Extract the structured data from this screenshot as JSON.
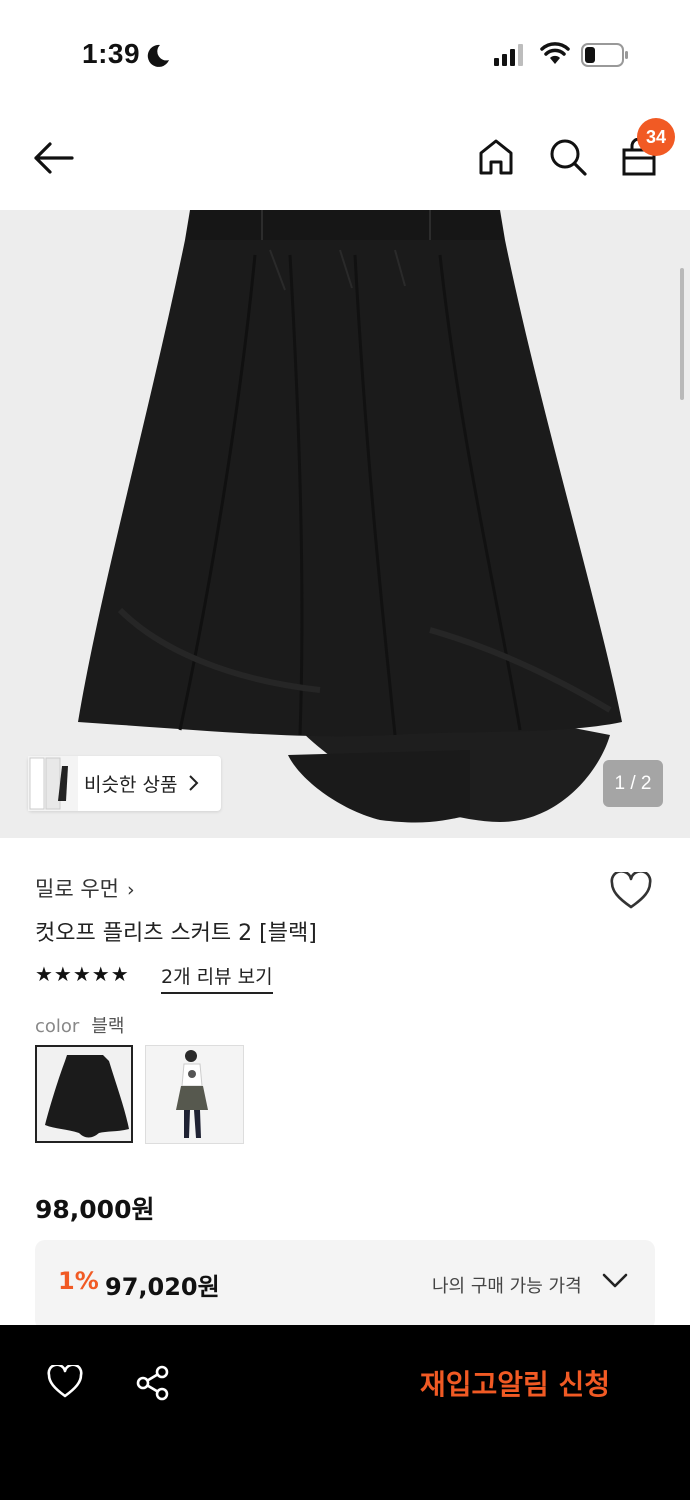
{
  "status_bar": {
    "time": "1:39",
    "icons": [
      "moon-icon",
      "signal-icon",
      "wifi-icon",
      "battery-icon"
    ]
  },
  "header": {
    "icons": [
      "back-icon",
      "home-icon",
      "search-icon",
      "cart-icon"
    ],
    "cart_count": "34"
  },
  "gallery": {
    "similar_label": "비슷한 상품",
    "page_indicator": "1 / 2",
    "background": "#ededed"
  },
  "product": {
    "brand": "밀로 우먼",
    "title": "컷오프 플리츠 스커트 2 [블랙]",
    "stars": "★★★★★",
    "review_link": "2개 리뷰 보기",
    "color_label": "color",
    "color_value": "블랙",
    "price": "98,000원",
    "discount_rate": "1%",
    "discount_price": "97,020원",
    "my_price_label": "나의 구매 가능 가격"
  },
  "bottom_bar": {
    "restock_label": "재입고알림 신청",
    "icons": [
      "heart-icon",
      "share-icon"
    ]
  },
  "colors": {
    "accent": "#f15a24",
    "bottom_bar": "#000000",
    "price_box": "#f4f4f4"
  }
}
